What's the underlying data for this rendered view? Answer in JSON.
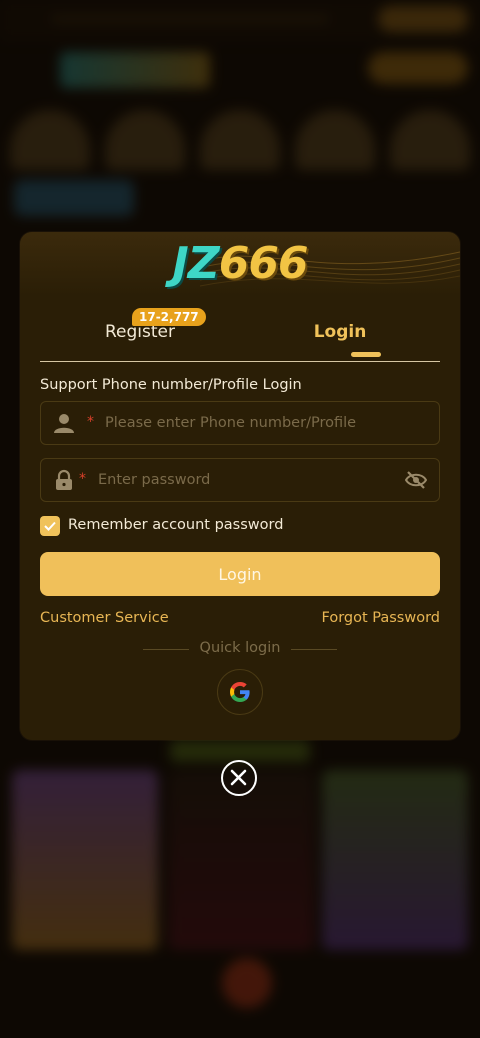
{
  "brand": {
    "logo_text_1": "JZ",
    "logo_text_2": "666"
  },
  "tabs": {
    "register": {
      "label": "Register",
      "badge": "17-2,777"
    },
    "login": {
      "label": "Login",
      "active": true
    }
  },
  "form": {
    "section_label": "Support Phone number/Profile Login",
    "phone": {
      "placeholder": "Please enter Phone number/Profile",
      "value": "",
      "icon": "user-icon",
      "required_mark": "*"
    },
    "password": {
      "placeholder": "Enter password",
      "value": "",
      "icon": "lock-icon",
      "toggle_icon": "eye-off-icon",
      "required_mark": "*"
    },
    "remember": {
      "label": "Remember account password",
      "checked": true
    },
    "submit_label": "Login"
  },
  "links": {
    "customer_service": "Customer Service",
    "forgot_password": "Forgot Password"
  },
  "quick_login": {
    "label": "Quick login",
    "providers": [
      "google-icon"
    ]
  },
  "close": {
    "icon": "close-icon"
  },
  "colors": {
    "modal_bg": "#2a1e06",
    "accent": "#f0c25a",
    "link": "#e8b654",
    "required": "#d8402a",
    "badge": "#e8a21c",
    "logo_teal": "#3ed6c6",
    "logo_gold": "#f2c444"
  }
}
